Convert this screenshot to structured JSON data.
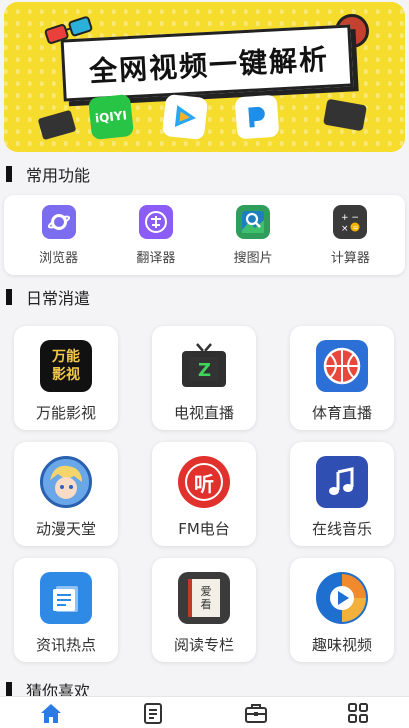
{
  "banner": {
    "title": "全网视频一键解析",
    "tiles": [
      "iQIYI",
      "tencent-video",
      "pptv"
    ]
  },
  "sections": {
    "common": "常用功能",
    "leisure": "日常消遣",
    "guess": "猜你喜欢"
  },
  "functions": [
    {
      "label": "浏览器",
      "icon": "browser-icon",
      "color": "#7b6cf0"
    },
    {
      "label": "翻译器",
      "icon": "translate-icon",
      "color": "#8b5cf6"
    },
    {
      "label": "搜图片",
      "icon": "image-search-icon",
      "color": "#2f9e5a"
    },
    {
      "label": "计算器",
      "icon": "calculator-icon",
      "color": "#3a3a3a"
    }
  ],
  "grid": [
    {
      "label": "万能影视",
      "icon": "universal-movie-icon"
    },
    {
      "label": "电视直播",
      "icon": "tv-live-icon"
    },
    {
      "label": "体育直播",
      "icon": "sports-live-icon"
    },
    {
      "label": "动漫天堂",
      "icon": "anime-icon"
    },
    {
      "label": "FM电台",
      "icon": "fm-radio-icon"
    },
    {
      "label": "在线音乐",
      "icon": "music-icon"
    },
    {
      "label": "资讯热点",
      "icon": "news-icon"
    },
    {
      "label": "阅读专栏",
      "icon": "reading-icon"
    },
    {
      "label": "趣味视频",
      "icon": "fun-video-icon"
    }
  ],
  "icon_text": {
    "movie_line1": "万能",
    "movie_line2": "影视",
    "tv_letter": "Z",
    "fm_char": "听",
    "reading_line1": "爱",
    "reading_line2": "看",
    "iqiyi": "iQIYI"
  },
  "nav": [
    "home-icon",
    "notes-icon",
    "toolbox-icon",
    "apps-grid-icon"
  ],
  "colors": {
    "accent": "#2c7be5",
    "banner": "#f6dc2c"
  }
}
